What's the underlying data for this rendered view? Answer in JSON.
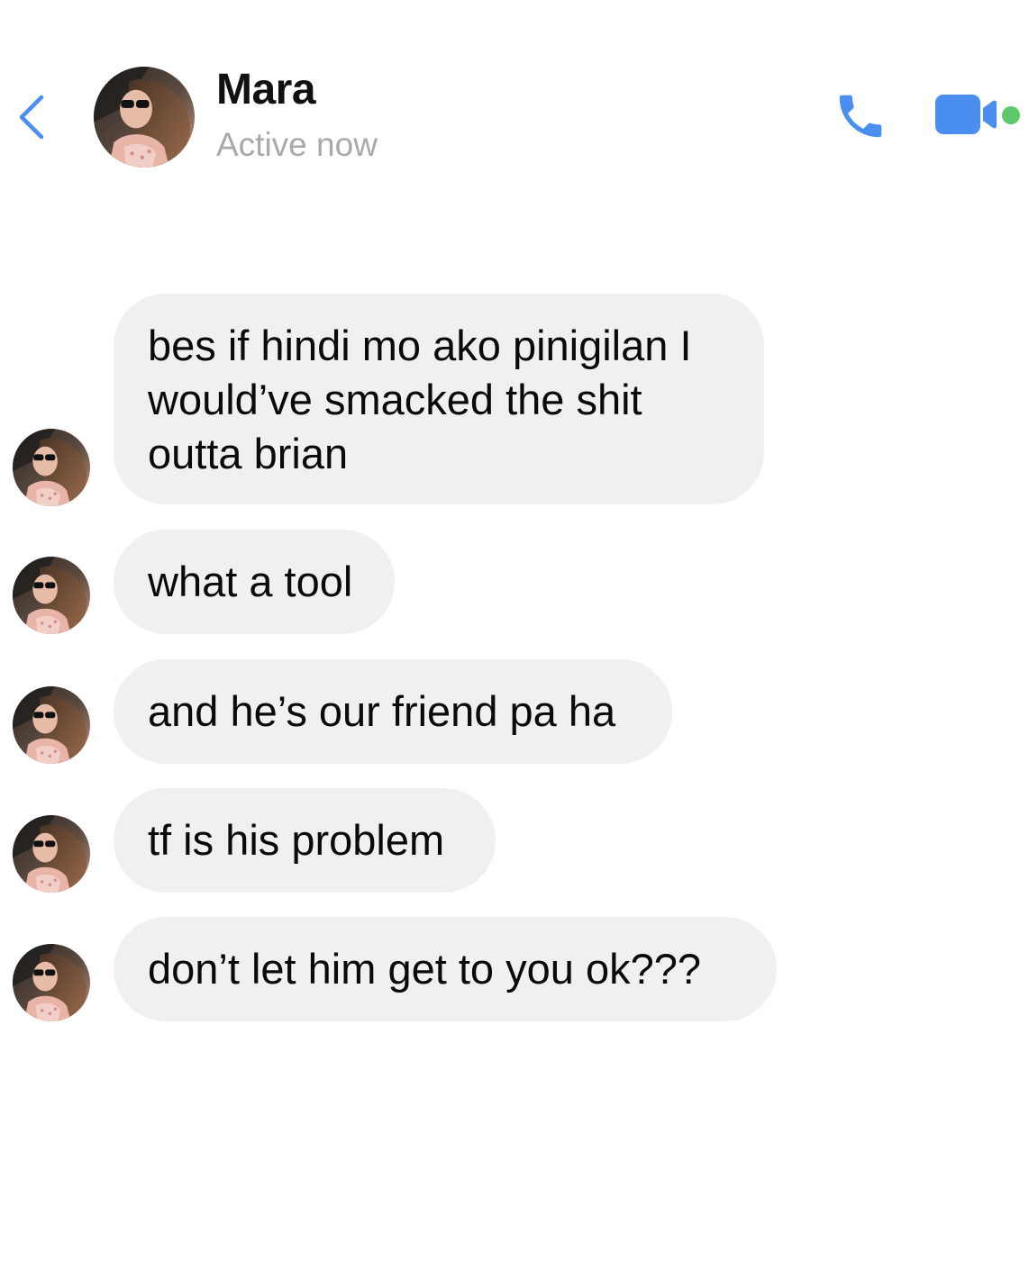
{
  "header": {
    "contact_name": "Mara",
    "status": "Active now",
    "icons": {
      "back": "chevron-left-icon",
      "call": "phone-icon",
      "video": "video-camera-icon",
      "online": "online-dot-icon"
    }
  },
  "colors": {
    "accent": "#4a8ef0",
    "online": "#5bc86a",
    "bubble_bg": "#f0f0f0",
    "status_text": "#a9a9a9"
  },
  "messages": [
    {
      "text": "bes if hindi mo ako pinigilan I\nwould’ve smacked the shit\noutta brian"
    },
    {
      "text": "what a tool"
    },
    {
      "text": "and he’s our friend pa ha"
    },
    {
      "text": "tf is his problem"
    },
    {
      "text": "don’t let him get to you ok???"
    }
  ]
}
